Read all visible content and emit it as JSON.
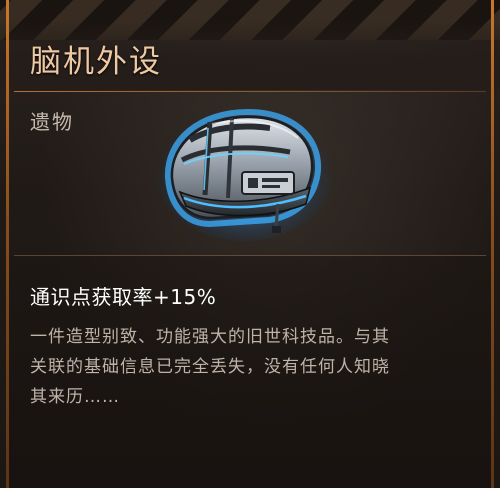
{
  "item": {
    "name": "脑机外设",
    "category": "遗物",
    "effect": "通识点获取率+15%",
    "description": "一件造型别致、功能强大的旧世科技品。与其\n关联的基础信息已完全丢失，没有任何人知晓\n其来历……",
    "icon": "helmet-icon"
  },
  "colors": {
    "title": "#efc8a4",
    "accent_trim": "#c8782e",
    "glow": "#35a8ff",
    "effect_text": "#ffffff",
    "description_text": "#bfb3a8"
  }
}
